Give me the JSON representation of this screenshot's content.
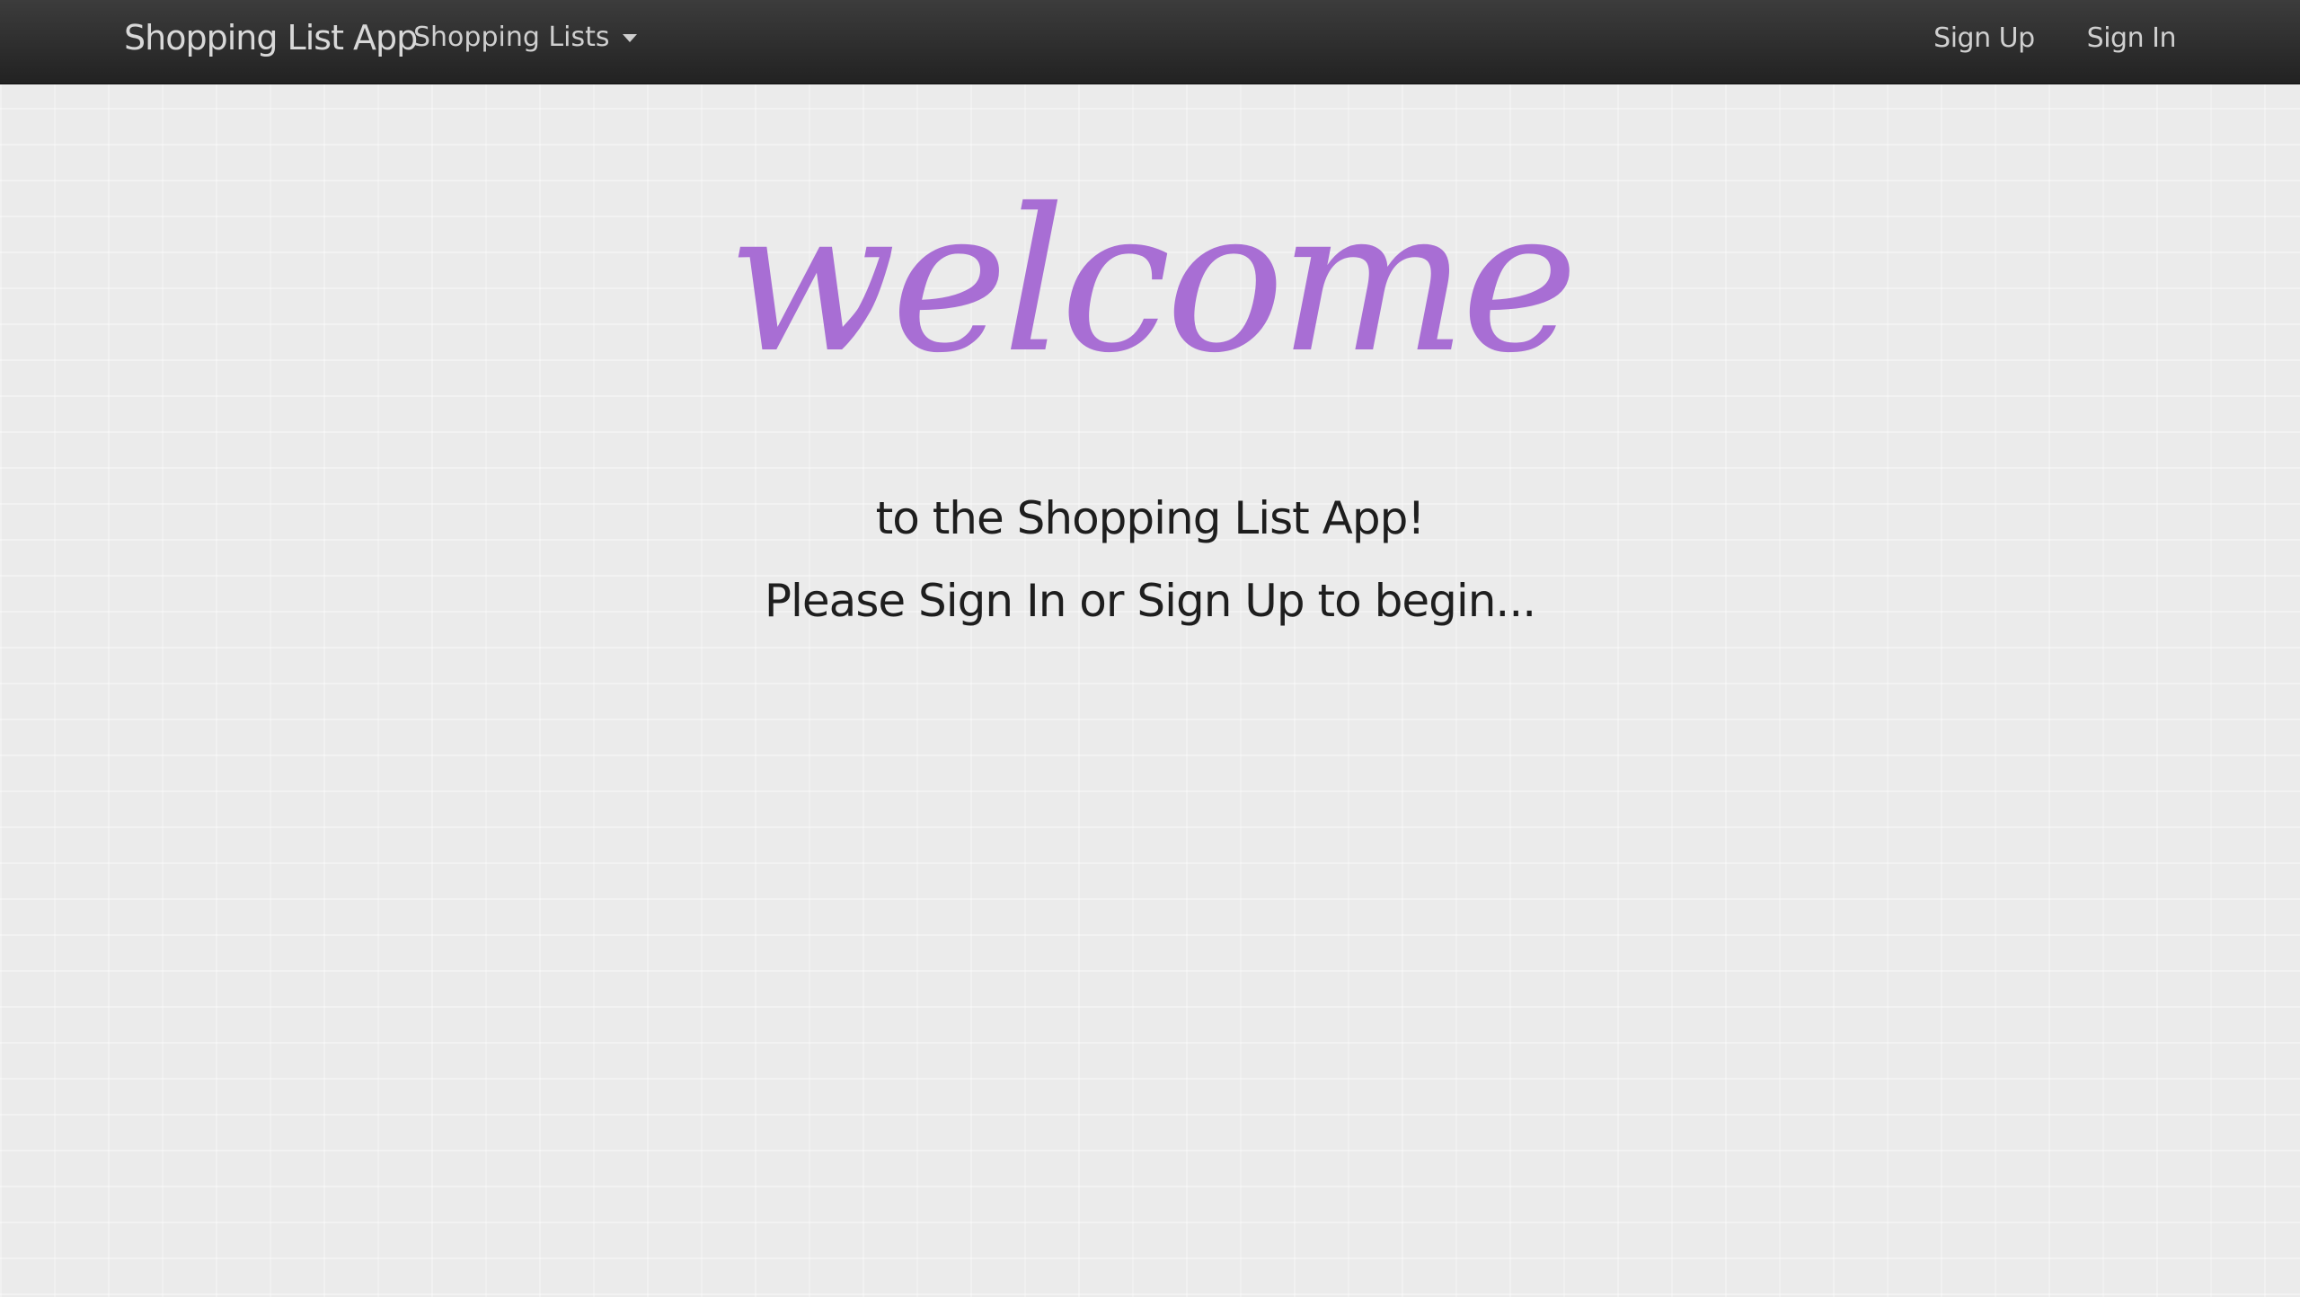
{
  "navbar": {
    "brand": "Shopping List App",
    "dropdown_label": "Shopping Lists",
    "sign_up": "Sign Up",
    "sign_in": "Sign In"
  },
  "hero": {
    "welcome": "welcome",
    "line1": "to the Shopping List App!",
    "line2": "Please Sign In or Sign Up to begin..."
  },
  "colors": {
    "accent": "#a86ed4",
    "navbar": "#2b2b2b",
    "background": "#ebebeb"
  }
}
